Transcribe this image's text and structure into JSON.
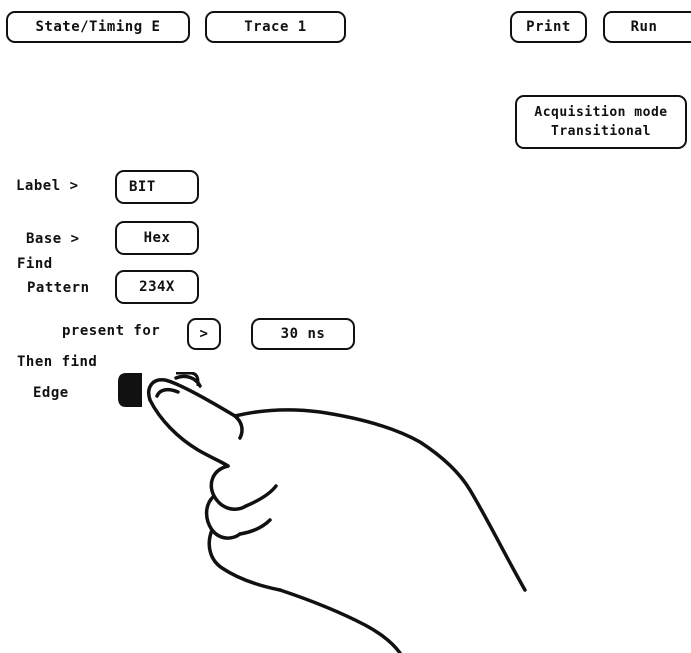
{
  "menu": {
    "state_timing": "State/Timing E",
    "trace": "Trace 1",
    "print": "Print",
    "run": "Run"
  },
  "acquisition": {
    "line1": "Acquisition mode",
    "line2": "Transitional"
  },
  "trigger": {
    "label_caption": "Label >",
    "label_value": "BIT",
    "base_caption": "Base >",
    "base_value": "Hex",
    "find_caption": "Find",
    "pattern_caption": "Pattern",
    "pattern_value": "234X",
    "present_for_caption": "present for",
    "present_for_op": ">",
    "duration_value": "30 ns",
    "then_find_caption": "Then find",
    "edge_caption": "Edge"
  }
}
